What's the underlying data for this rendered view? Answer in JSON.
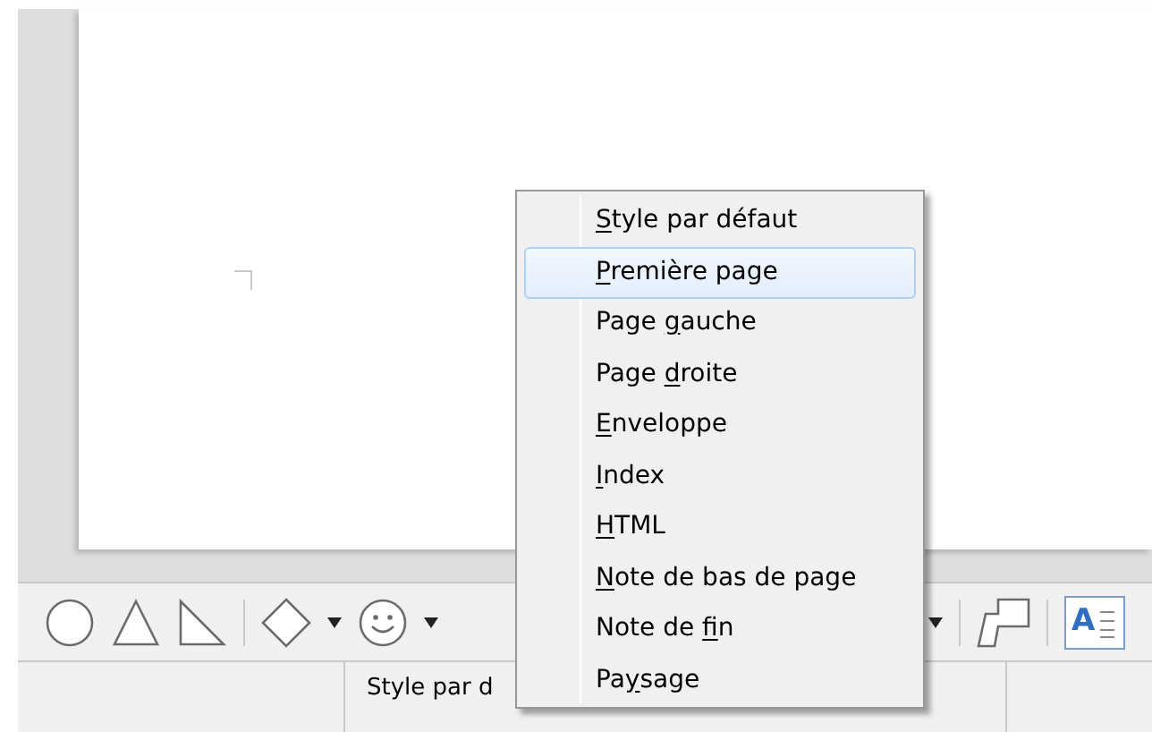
{
  "toolbar": {
    "items": [
      {
        "kind": "circle"
      },
      {
        "kind": "triangle"
      },
      {
        "kind": "right-triangle"
      },
      {
        "kind": "separator"
      },
      {
        "kind": "diamond"
      },
      {
        "kind": "dropdown"
      },
      {
        "kind": "smiley"
      },
      {
        "kind": "dropdown"
      },
      {
        "kind": "spacer"
      },
      {
        "kind": "dropdown"
      },
      {
        "kind": "separator"
      },
      {
        "kind": "polygon"
      },
      {
        "kind": "separator"
      },
      {
        "kind": "text-frame",
        "glyph": "A"
      }
    ]
  },
  "status_bar": {
    "page_style": "Style par d"
  },
  "context_menu": {
    "items": [
      {
        "key": "S",
        "after": "tyle par défaut",
        "selected": false
      },
      {
        "key": "P",
        "after": "remière page",
        "selected": true
      },
      {
        "before": "Page ",
        "key": "g",
        "after": "auche",
        "selected": false
      },
      {
        "before": "Page ",
        "key": "d",
        "after": "roite",
        "selected": false
      },
      {
        "key": "E",
        "after": "nveloppe",
        "selected": false
      },
      {
        "key": "I",
        "after": "ndex",
        "selected": false
      },
      {
        "key": "H",
        "after": "TML",
        "selected": false
      },
      {
        "key": "N",
        "after": "ote de bas de page",
        "selected": false
      },
      {
        "before": "Note de ",
        "key": "f",
        "after": "in",
        "selected": false
      },
      {
        "before": "Pa",
        "key": "y",
        "after": "sage",
        "selected": false
      }
    ]
  }
}
